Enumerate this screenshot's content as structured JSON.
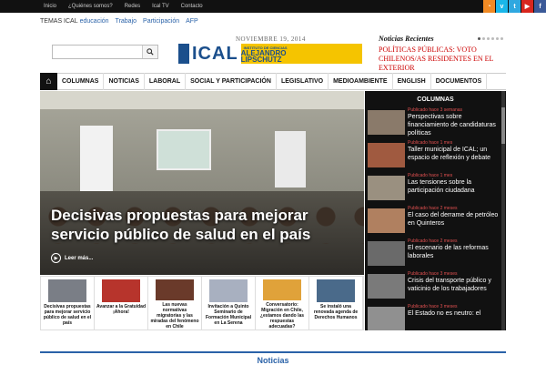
{
  "topbar": {
    "links": [
      "Inicio",
      "¿Quiénes somos?",
      "Redes",
      "Ical TV",
      "Contacto"
    ]
  },
  "social": [
    {
      "icon": "rss-icon",
      "glyph": "◔",
      "color": "#f08a24"
    },
    {
      "icon": "vimeo-icon",
      "glyph": "v",
      "color": "#1ab7ea"
    },
    {
      "icon": "twitter-icon",
      "glyph": "t",
      "color": "#2fa8e0"
    },
    {
      "icon": "youtube-icon",
      "glyph": "▶",
      "color": "#d8261e"
    },
    {
      "icon": "facebook-icon",
      "glyph": "f",
      "color": "#3b5998"
    }
  ],
  "temas": {
    "label": "TEMAS ICAL",
    "items": [
      "educación",
      "Trabajo",
      "Participación",
      "AFP"
    ]
  },
  "date": "NOVIEMBRE 19, 2014",
  "logo": {
    "main": "ICAL",
    "sub1": "INSTITUTO DE CIENCIAS",
    "sub2": "ALEJANDRO",
    "sub3": "LIPSCHUTZ"
  },
  "search": {
    "placeholder": "",
    "value": ""
  },
  "recent": {
    "title": "Noticias Recientes",
    "headline": "POLÍTICAS PÚBLICAS: VOTO CHILENOS/AS RESIDENTES EN EL EXTERIOR"
  },
  "nav": [
    "COLUMNAS",
    "NOTICIAS",
    "LABORAL",
    "SOCIAL Y PARTICIPACIÓN",
    "LEGISLATIVO",
    "MEDIOAMBIENTE",
    "ENGLISH",
    "DOCUMENTOS"
  ],
  "hero": {
    "title": "Decisivas propuestas para mejorar servicio público de salud en el país",
    "more": "Leer más..."
  },
  "thumbs": [
    {
      "caption": "Decisivas propuestas para mejorar servicio público de salud en el país",
      "color": "#7a7e86"
    },
    {
      "caption": "Avanzar a la Gratuidad ¡Ahora!",
      "color": "#b7342c"
    },
    {
      "caption": "Las nuevas normativas migratorias y las miradas del fenómeno en Chile",
      "color": "#6a3a2a"
    },
    {
      "caption": "Invitación a Quinto Seminario de Formación Municipal en La Serena",
      "color": "#a8b0c0"
    },
    {
      "caption": "Conversatorio: Migración en Chile, ¿estamos dando las respuestas adecuadas?",
      "color": "#e0a23a"
    },
    {
      "caption": "Se instaló una renovada agenda de Derechos Humanos",
      "color": "#4a6a8a"
    }
  ],
  "side": {
    "title": "COLUMNAS",
    "items": [
      {
        "meta": "Publicado hace 3 semanas",
        "title": "Perspectivas sobre financiamiento de candidaturas políticas",
        "color": "#8a7a6a"
      },
      {
        "meta": "Publicado hace 1 mes",
        "title": "Taller municipal de ICAL; un espacio de reflexión y debate",
        "color": "#a05a40"
      },
      {
        "meta": "Publicado hace 1 mes",
        "title": "Las tensiones sobre la participación ciudadana",
        "color": "#9a9080"
      },
      {
        "meta": "Publicado hace 2 meses",
        "title": "El caso del derrame de petróleo en Quinteros",
        "color": "#b08060"
      },
      {
        "meta": "Publicado hace 2 meses",
        "title": "El escenario de las reformas laborales",
        "color": "#6a6a6a"
      },
      {
        "meta": "Publicado hace 3 meses",
        "title": "Crisis del transporte público y vaticinio de los trabajadores",
        "color": "#7a7a7a"
      },
      {
        "meta": "Publicado hace 3 meses",
        "title": "El Estado no es neutro: el",
        "color": "#909090"
      }
    ]
  },
  "bottom": {
    "title": "Noticias"
  }
}
